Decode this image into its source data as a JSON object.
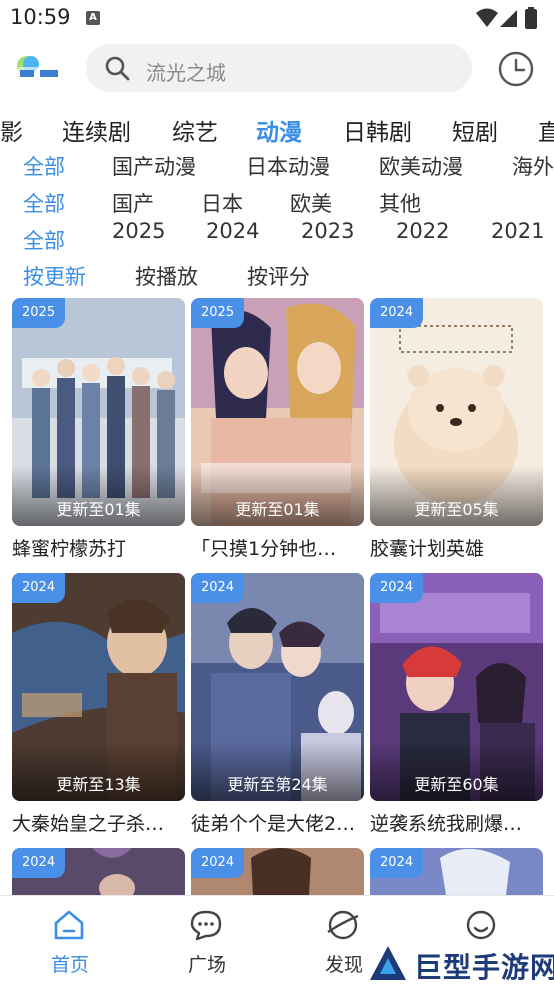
{
  "status_bar": {
    "time": "10:59",
    "notification_glyph": "A"
  },
  "header": {
    "logo_alt": "影视",
    "search_placeholder": "流光之城",
    "icons": [
      "search-icon",
      "history-clock-icon"
    ]
  },
  "category_tabs": [
    "影",
    "连续剧",
    "综艺",
    "动漫",
    "日韩剧",
    "短剧",
    "直"
  ],
  "active_category": "动漫",
  "filters": {
    "type": [
      "全部",
      "国产动漫",
      "日本动漫",
      "欧美动漫",
      "海外"
    ],
    "region": [
      "全部",
      "国产",
      "日本",
      "欧美",
      "其他"
    ],
    "year": [
      "全部",
      "2025",
      "2024",
      "2023",
      "2022",
      "2021"
    ],
    "sort": [
      "按更新",
      "按播放",
      "按评分"
    ]
  },
  "grid": [
    {
      "year": "2025",
      "episode": "更新至01集",
      "title": "蜂蜜柠檬苏打"
    },
    {
      "year": "2025",
      "episode": "更新至01集",
      "title": "「只摸1分钟也…"
    },
    {
      "year": "2024",
      "episode": "更新至05集",
      "title": "胶囊计划英雄"
    },
    {
      "year": "2024",
      "episode": "更新至13集",
      "title": "大秦始皇之子杀…"
    },
    {
      "year": "2024",
      "episode": "更新至第24集",
      "title": "徒弟个个是大佬2…"
    },
    {
      "year": "2024",
      "episode": "更新至60集",
      "title": "逆袭系统我刷爆…"
    },
    {
      "year": "2024",
      "episode": "",
      "title": ""
    },
    {
      "year": "2024",
      "episode": "",
      "title": ""
    },
    {
      "year": "2024",
      "episode": "",
      "title": ""
    }
  ],
  "bottom_nav": [
    {
      "label": "首页",
      "icon": "home-icon",
      "active": true
    },
    {
      "label": "广场",
      "icon": "chat-icon",
      "active": false
    },
    {
      "label": "发现",
      "icon": "planet-icon",
      "active": false
    },
    {
      "label": "",
      "icon": "smile-icon",
      "active": false
    }
  ],
  "watermark": {
    "text": "巨型手游网"
  },
  "colors": {
    "accent": "#3a8ee6",
    "badge": "#4a8fe8",
    "search_bg": "#f1f1f3"
  }
}
